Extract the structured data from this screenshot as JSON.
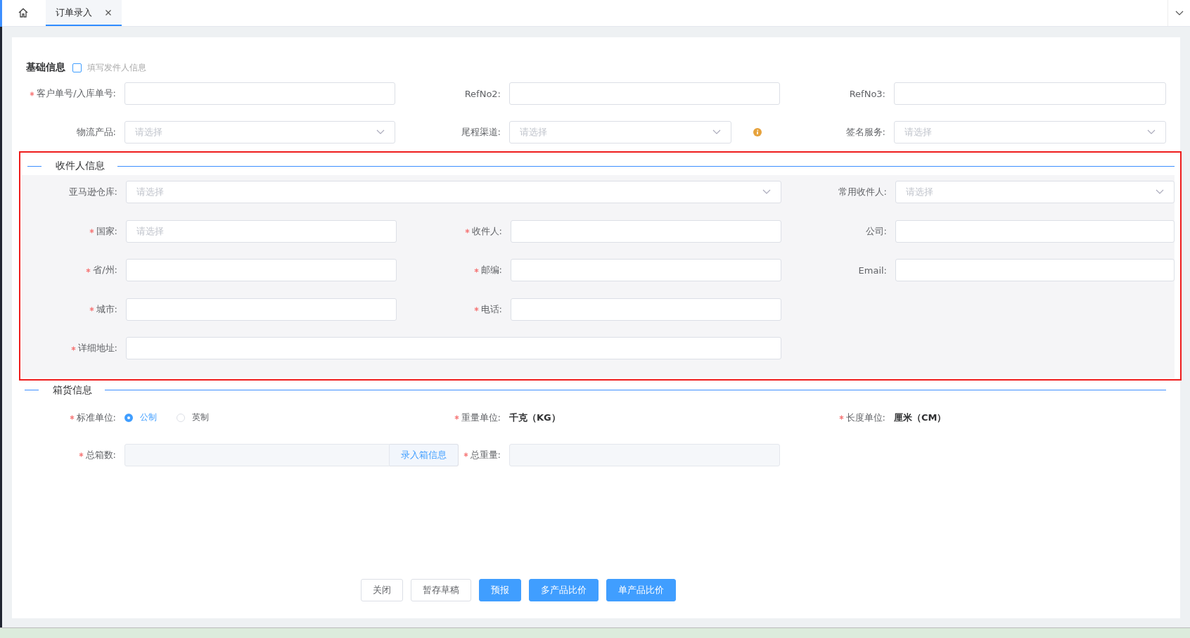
{
  "tabs": [
    {
      "kind": "home",
      "selected": false
    },
    {
      "kind": "page",
      "label": "订单录入",
      "selected": true,
      "closable": true
    }
  ],
  "basic": {
    "title": "基础信息",
    "sender_checkbox": {
      "label": "填写发件人信息",
      "checked": false
    },
    "rows": [
      [
        {
          "label": "客户单号/入库单号:",
          "required": true,
          "kind": "input"
        },
        {
          "label": "RefNo2:",
          "required": false,
          "kind": "input"
        },
        {
          "label": "RefNo3:",
          "required": false,
          "kind": "input"
        }
      ],
      [
        {
          "label": "物流产品:",
          "required": false,
          "kind": "select",
          "placeholder": "请选择"
        },
        {
          "label": "尾程渠道:",
          "required": false,
          "kind": "select",
          "placeholder": "请选择",
          "info": true
        },
        {
          "label": "签名服务:",
          "required": false,
          "kind": "select",
          "placeholder": "请选择"
        }
      ]
    ]
  },
  "receiver": {
    "title": "收件人信息",
    "rows": [
      [
        {
          "label": "亚马逊仓库:",
          "required": false,
          "kind": "select",
          "placeholder": "请选择",
          "wide": true
        },
        "",
        "",
        {
          "label": "常用收件人:",
          "required": false,
          "kind": "select",
          "placeholder": "请选择"
        }
      ],
      [
        {
          "label": "国家:",
          "required": true,
          "kind": "input",
          "placeholder": "请选择"
        },
        {
          "label": "收件人:",
          "required": true,
          "kind": "input"
        },
        {
          "label": "公司:",
          "required": false,
          "kind": "input"
        }
      ],
      [
        {
          "label": "省/州:",
          "required": true,
          "kind": "input"
        },
        {
          "label": "邮编:",
          "required": true,
          "kind": "input"
        },
        {
          "label": "Email:",
          "required": false,
          "kind": "input"
        }
      ],
      [
        {
          "label": "城市:",
          "required": true,
          "kind": "input"
        },
        {
          "label": "电话:",
          "required": true,
          "kind": "input"
        }
      ],
      [
        {
          "label": "详细地址:",
          "required": true,
          "kind": "input",
          "wide": true
        },
        "",
        ""
      ]
    ]
  },
  "cargo": {
    "title": "箱货信息",
    "rows": [
      [
        {
          "label": "标准单位:",
          "required": true,
          "kind": "radio",
          "options": [
            {
              "label": "公制",
              "selected": true
            },
            {
              "label": "英制",
              "selected": false
            }
          ]
        },
        {
          "label": "重量单位:",
          "required": true,
          "kind": "text",
          "value": "千克（KG）"
        },
        {
          "label": "长度单位:",
          "required": true,
          "kind": "text",
          "value": "厘米（CM）"
        }
      ],
      [
        {
          "label": "总箱数:",
          "required": true,
          "kind": "input",
          "disabled": true,
          "append_button": "录入箱信息"
        },
        {
          "label": "总重量:",
          "required": true,
          "kind": "input",
          "disabled": true
        }
      ]
    ]
  },
  "buttons": [
    {
      "label": "关闭",
      "kind": "default"
    },
    {
      "label": "暂存草稿",
      "kind": "default"
    },
    {
      "label": "预报",
      "kind": "primary"
    },
    {
      "label": "多产品比价",
      "kind": "primary"
    },
    {
      "label": "单产品比价",
      "kind": "primary"
    }
  ]
}
